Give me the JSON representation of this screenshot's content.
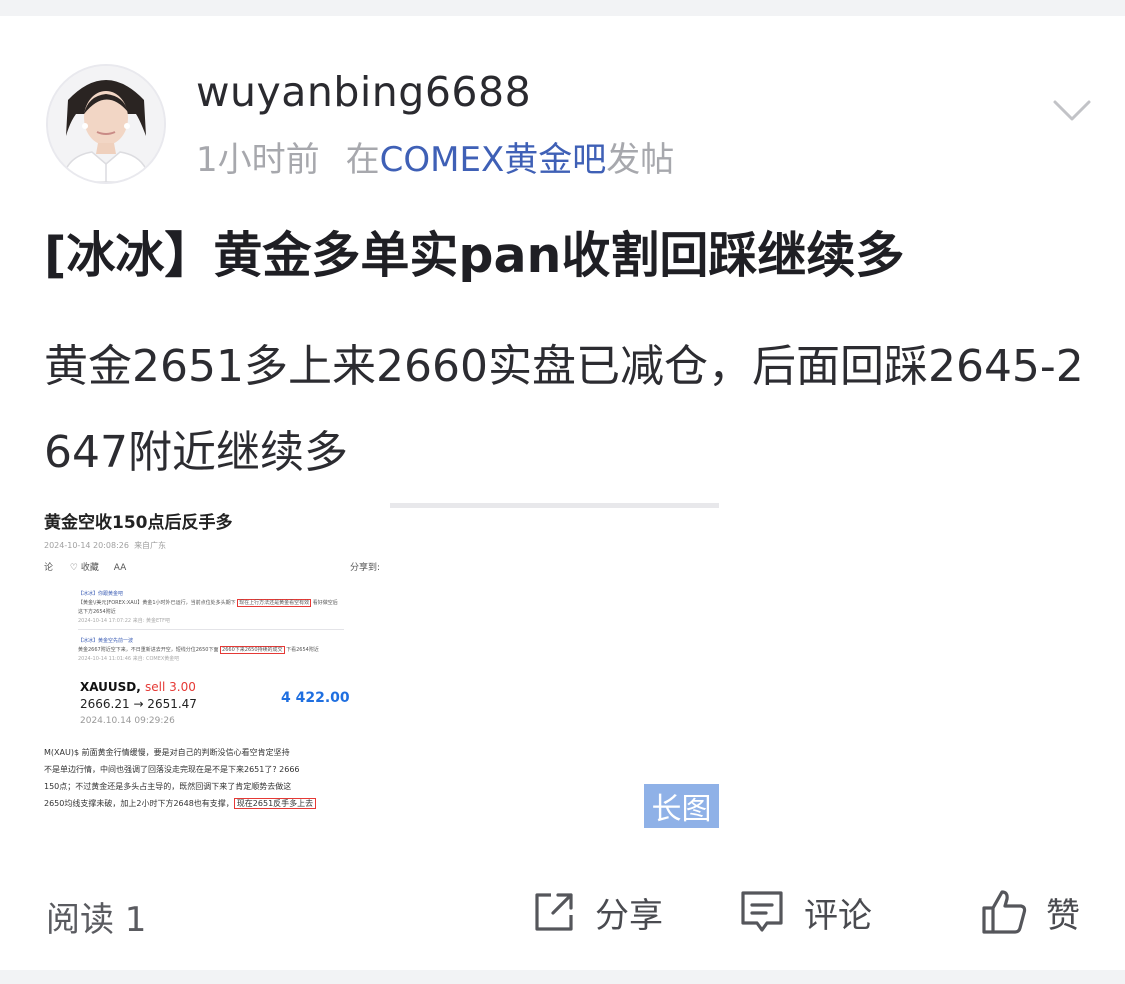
{
  "post": {
    "username": "wuyanbing6688",
    "time": "1小时前",
    "forum_prefix": "在",
    "forum": "COMEX黄金吧",
    "forum_suffix": "发帖",
    "title": "[冰冰】黄金多单实pan收割回踩继续多",
    "body": "黄金2651多上来2660实盘已减仓，后面回踩2645-2647附近继续多"
  },
  "image": {
    "headline": "黄金空收150点后反手多",
    "date": "2024-10-14 20:08:26",
    "location": "来自广东",
    "comment": "论",
    "favorite": "收藏",
    "font_size": "AA",
    "share_to": "分享到:",
    "quote1_title": "【冰冰】你跟黄金吧",
    "quote1_text": "【黄金\\/美元]FOREX:XAU】黄金1小时外已运行，当前点位处多头期下",
    "quote1_box": "现在上行方法还是黄金看空有效",
    "quote1_tail": "看好做空后",
    "quote1_tail2": "这下方2654附近",
    "quote1_meta": "2024-10-14 17:07:22  来自: 黄金ETF吧",
    "quote2_title": "【冰冰】黄金空先前一波",
    "quote2_text": "黄金2667附近空下来，不日重新进去开空，短线分位2650下面",
    "quote2_box": "2660下来2650持续的成交",
    "quote2_tail": "下看2654附近",
    "quote2_meta": "2024-10-14 11:01:46  来自: COMEX黄金吧",
    "trade_symbol": "XAUUSD,",
    "trade_side": "sell 3.00",
    "trade_prices": "2666.21 → 2651.47",
    "trade_time": "2024.10.14 09:29:26",
    "trade_profit": "4 422.00",
    "para_line1": "M(XAU)$ 前面黄金行情缓慢，要是对自己的判断没信心看空肯定坚持",
    "para_line2": "不是单边行情，中间也强调了回落没走完现在是不是下来2651了? 2666",
    "para_line3": "150点；不过黄金还是多头占主导的，既然回调下来了肯定顺势去做这",
    "para_line4": "2650均线支撑未破，加上2小时下方2648也有支撑，",
    "para_box": "现在2651反手多上去",
    "long_badge": "长图"
  },
  "footer": {
    "read": "阅读 1",
    "share": "分享",
    "comment": "评论",
    "like": "赞"
  },
  "colors": {
    "forum_link": "#3f60b6",
    "badge": "#8fb1e7",
    "profit": "#1f6fe0",
    "sell": "#e53935",
    "highlight_box": "#e53935"
  }
}
